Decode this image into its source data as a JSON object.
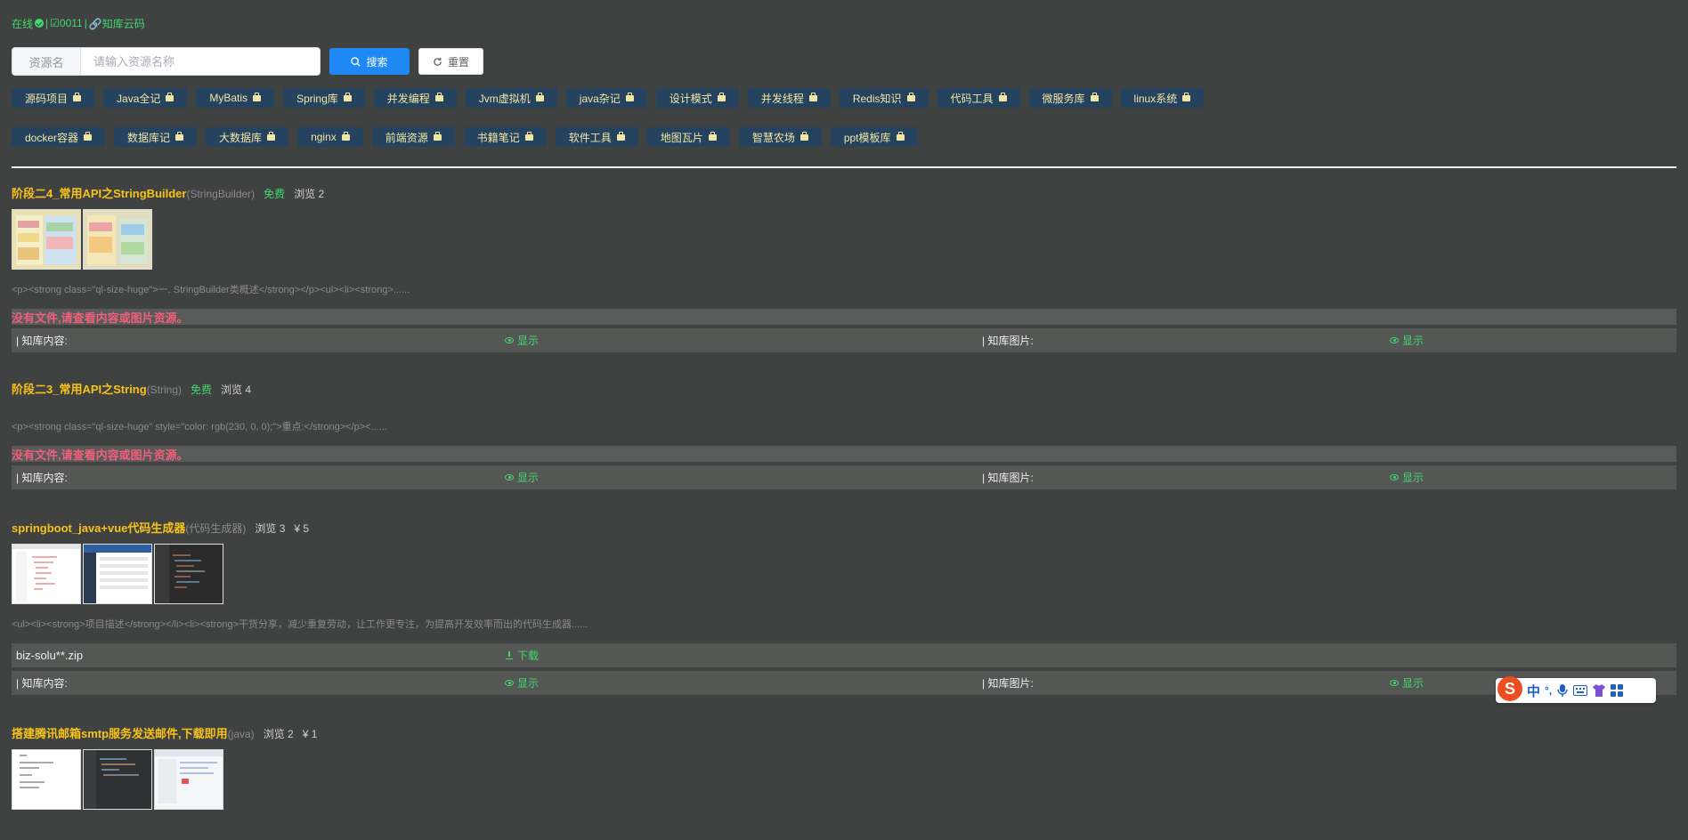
{
  "status": {
    "online": "在线",
    "sep1": "|",
    "id": "☑0011",
    "sep2": "|",
    "link": "🔗知库云码"
  },
  "search": {
    "label": "资源名",
    "placeholder": "请输入资源名称",
    "search_btn": "搜索",
    "reset_btn": "重置"
  },
  "tags_row1": [
    "源码项目",
    "Java全记",
    "MyBatis",
    "Spring库",
    "并发编程",
    "Jvm虚拟机",
    "java杂记",
    "设计模式",
    "并发线程",
    "Redis知识",
    "代码工具",
    "微服务库",
    "linux系统"
  ],
  "tags_row2": [
    "docker容器",
    "数据库记",
    "大数据库",
    "nginx",
    "前端资源",
    "书籍笔记",
    "软件工具",
    "地图瓦片",
    "智慧农场",
    "ppt模板库"
  ],
  "resources": [
    {
      "name": "阶段二4_常用API之StringBuilder",
      "category": "(StringBuilder)",
      "free": "免费",
      "views": "浏览 2",
      "desc": "<p><strong class=\"ql-size-huge\">一. StringBuilder类概述</strong></p><ul><li><strong>......",
      "nofile": "没有文件,请查看内容或图片资源。",
      "content_label": "| 知库内容:",
      "content_action": "显示",
      "image_label": "| 知库图片:",
      "image_action": "显示"
    },
    {
      "name": "阶段二3_常用API之String",
      "category": "(String)",
      "free": "免费",
      "views": "浏览 4",
      "desc": "<p><strong class=\"ql-size-huge\" style=\"color: rgb(230, 0, 0);\">重点:</strong></p><......",
      "nofile": "没有文件,请查看内容或图片资源。",
      "content_label": "| 知库内容:",
      "content_action": "显示",
      "image_label": "| 知库图片:",
      "image_action": "显示"
    },
    {
      "name": "springboot_java+vue代码生成器",
      "category": "(代码生成器)",
      "views": "浏览 3",
      "price": "¥ 5",
      "desc": "<ul><li><strong>项目描述</strong></li><li><strong>干货分享，减少重复劳动，让工作更专注，为提高开发效率而出的代码生成器......",
      "file_name": "biz-solu**.zip",
      "file_action": "下载",
      "content_label": "| 知库内容:",
      "content_action": "显示",
      "image_label": "| 知库图片:",
      "image_action": "显示"
    },
    {
      "name": "搭建腾讯邮箱smtp服务发送邮件,下载即用",
      "category": "(java)",
      "views": "浏览 2",
      "price": "¥ 1"
    }
  ],
  "ime": {
    "logo": "S",
    "lang": "中",
    "punct": "°,"
  }
}
